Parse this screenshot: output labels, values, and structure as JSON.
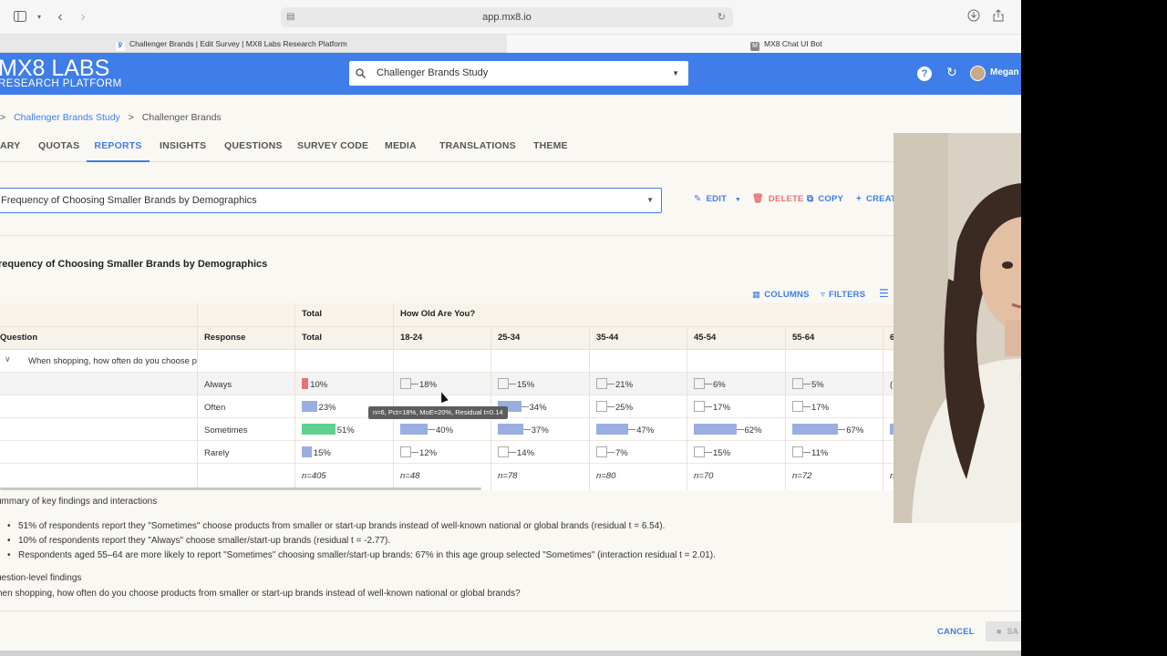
{
  "browser": {
    "url": "app.mx8.io",
    "tabs": [
      {
        "title": "Challenger Brands | Edit Survey | MX8 Labs Research Platform",
        "favicon": "mx8-logo",
        "active": false
      },
      {
        "title": "MX8 Chat UI Bot",
        "favicon": "M",
        "active": true
      }
    ]
  },
  "app": {
    "logo_line1": "MX8 LABS",
    "logo_line2": "RESEARCH PLATFORM",
    "study_selector": "Challenger Brands Study",
    "user_name": "Megan",
    "brand_color": "#3f7de8"
  },
  "breadcrumb": {
    "root": ">",
    "study": "Challenger Brands Study",
    "current": "Challenger Brands"
  },
  "nav_tabs": [
    {
      "label": "ARY",
      "active": false
    },
    {
      "label": "QUOTAS",
      "active": false
    },
    {
      "label": "REPORTS",
      "active": true
    },
    {
      "label": "INSIGHTS",
      "active": false
    },
    {
      "label": "QUESTIONS",
      "active": false
    },
    {
      "label": "SURVEY CODE",
      "active": false
    },
    {
      "label": "MEDIA",
      "active": false
    },
    {
      "label": "TRANSLATIONS",
      "active": false
    },
    {
      "label": "THEME",
      "active": false
    }
  ],
  "report": {
    "selected": "Frequency of Choosing Smaller Brands by Demographics",
    "actions": {
      "edit": "EDIT",
      "delete": "DELETE",
      "copy": "COPY",
      "create": "CREAT"
    },
    "title": "requency of Choosing Smaller Brands by Demographics",
    "tools": {
      "columns": "COLUMNS",
      "filters": "FILTERS"
    }
  },
  "table": {
    "group_headers": {
      "total": "Total",
      "age": "How Old Are You?"
    },
    "headers": {
      "question": "Question",
      "response": "Response",
      "total": "Total"
    },
    "age_columns": [
      "18-24",
      "25-34",
      "35-44",
      "45-54",
      "55-64",
      "6"
    ],
    "question_text": "When shopping, how often do you choose products from smaller or start-up brands instead of well-known national or global brands?",
    "rows": [
      {
        "response": "Always",
        "total": "10%",
        "total_value": 10,
        "total_color": "#e57373",
        "cells": [
          "18%",
          "15%",
          "21%",
          "6%",
          "5%",
          "("
        ],
        "values": [
          18,
          15,
          21,
          6,
          5,
          0
        ]
      },
      {
        "response": "Often",
        "total": "23%",
        "total_value": 23,
        "total_color": "#9aaee2",
        "cells": [
          "",
          "34%",
          "25%",
          "17%",
          "17%",
          ""
        ],
        "values": [
          0,
          34,
          25,
          17,
          17,
          0
        ]
      },
      {
        "response": "Sometimes",
        "total": "51%",
        "total_value": 51,
        "total_color": "#5fd08f",
        "cells": [
          "40%",
          "37%",
          "47%",
          "62%",
          "67%",
          ""
        ],
        "values": [
          40,
          37,
          47,
          62,
          67,
          60
        ]
      },
      {
        "response": "Rarely",
        "total": "15%",
        "total_value": 15,
        "total_color": "#9aaee2",
        "cells": [
          "12%",
          "14%",
          "7%",
          "15%",
          "11%",
          ""
        ],
        "values": [
          12,
          14,
          7,
          15,
          11,
          0
        ]
      }
    ],
    "n_values": [
      "n=405",
      "n=48",
      "n=78",
      "n=80",
      "n=70",
      "n=72",
      "n"
    ],
    "tooltip": "n=6, Pct=18%, MoE=20%, Residual t=0.14"
  },
  "summary": {
    "heading": "ummary of key findings and interactions",
    "bullets": [
      "51% of respondents report they \"Sometimes\" choose products from smaller or start-up brands instead of well-known national or global brands (residual t = 6.54).",
      "10% of respondents report they \"Always\" choose smaller/start-up brands (residual t = -2.77).",
      "Respondents aged 55–64 are more likely to report \"Sometimes\" choosing smaller/start-up brands: 67% in this age group selected \"Sometimes\" (interaction residual t = 2.01)."
    ],
    "question_level_heading": "uestion-level findings",
    "question_level_text": "hen shopping, how often do you choose products from smaller or start-up brands instead of well-known national or global brands?"
  },
  "footer": {
    "cancel": "CANCEL",
    "save": "SA"
  }
}
